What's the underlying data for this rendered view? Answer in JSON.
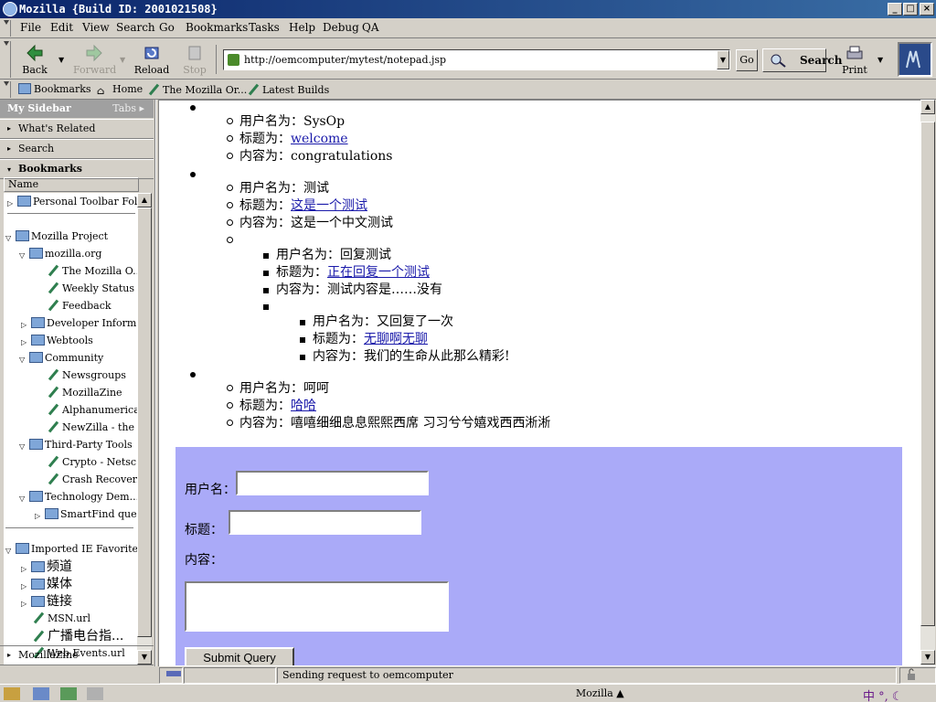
{
  "window": {
    "title": "Mozilla {Build ID: 2001021508}",
    "min": "_",
    "max": "□",
    "close": "×"
  },
  "menu": {
    "items": [
      "File",
      "Edit",
      "View",
      "Search",
      "Go",
      "Bookmarks",
      "Tasks",
      "Help",
      "Debug",
      "QA"
    ]
  },
  "nav": {
    "back": "Back",
    "forward": "Forward",
    "reload": "Reload",
    "stop": "Stop",
    "url": "http://oemcomputer/mytest/notepad.jsp",
    "go": "Go",
    "search": "Search",
    "print": "Print"
  },
  "personal": {
    "items": [
      "Bookmarks",
      "Home",
      "The Mozilla Or...",
      "Latest Builds"
    ]
  },
  "sidebar": {
    "title": "My Sidebar",
    "tabs": "Tabs",
    "panels": [
      "What's Related",
      "Search",
      "Bookmarks"
    ],
    "column": "Name",
    "tree": [
      "Personal Toolbar Fol...",
      "Mozilla Project",
      "mozilla.org",
      "The Mozilla O...",
      "Weekly Status ...",
      "Feedback",
      "Developer Inform...",
      "Webtools",
      "Community",
      "Newsgroups",
      "MozillaZine",
      "Alphanumerica...",
      "NewZilla - the ...",
      "Third-Party Tools",
      "Crypto - Netsc...",
      "Crash Recover...",
      "Technology Dem...",
      "SmartFind quer...",
      "Imported IE Favorites",
      "频道",
      "媒体",
      "链接",
      "MSN.url",
      "广播电台指...",
      "Web Events.url"
    ],
    "footer": "MozillaZine"
  },
  "content": {
    "entries": [
      {
        "user": "用户名为：SysOp",
        "title_label": "标题为：",
        "title_link": "welcome",
        "body": "内容为：congratulations"
      },
      {
        "user": "用户名为：测试",
        "title_label": "标题为：",
        "title_link": "这是一个测试",
        "body": "内容为：这是一个中文测试"
      },
      {
        "user": "用户名为：回复测试",
        "title_label": "标题为：",
        "title_link": "正在回复一个测试",
        "body": "内容为：测试内容是……没有"
      },
      {
        "user": "用户名为：又回复了一次",
        "title_label": "标题为：",
        "title_link": "无聊啊无聊",
        "body": "内容为：我们的生命从此那么精彩!"
      },
      {
        "user": "用户名为：呵呵",
        "title_label": "标题为：",
        "title_link": "哈哈",
        "body": "内容为：嘻嘻细细息息熙熙西席 习习兮兮嬉戏西西淅淅"
      }
    ],
    "form": {
      "user_label": "用户名：",
      "title_label": "标题：",
      "body_label": "内容：",
      "submit": "Submit Query"
    }
  },
  "status": {
    "text": "Sending request to oemcomputer"
  },
  "taskbar": {
    "center": "Mozilla ▲",
    "ime": "中 °, ☾"
  }
}
